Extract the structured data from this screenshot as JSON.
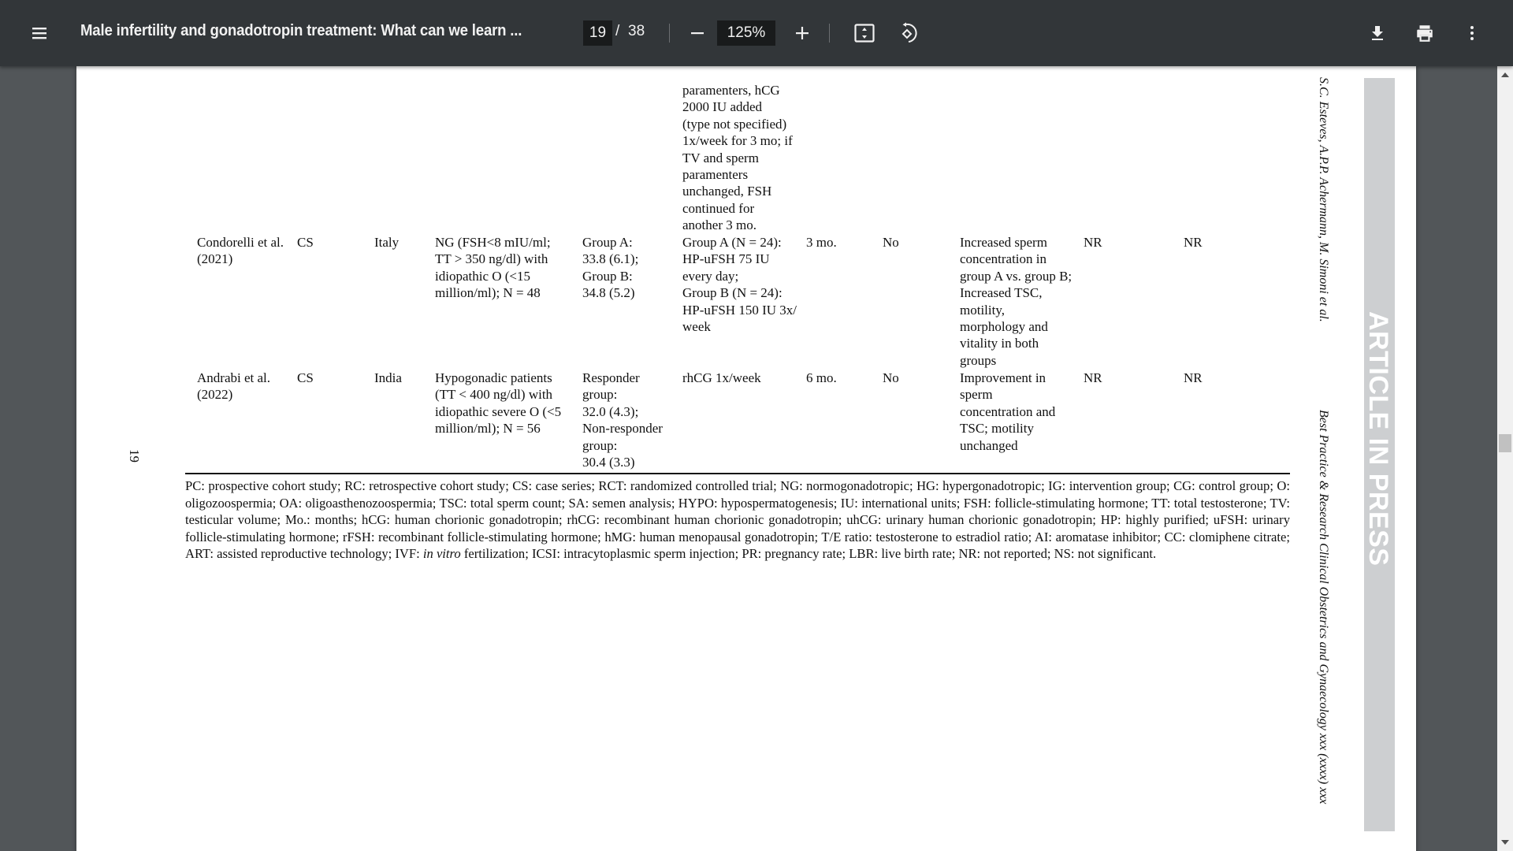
{
  "toolbar": {
    "menu_icon": "hamburger-menu-icon",
    "title": "Male infertility and gonadotropin treatment: What can we learn ...",
    "current_page": "19",
    "page_separator": "/",
    "total_pages": "38",
    "zoom_out_icon": "minus-icon",
    "zoom_level": "125%",
    "zoom_in_icon": "plus-icon",
    "fit_icon": "fit-to-page-icon",
    "rotate_icon": "rotate-counterclockwise-icon",
    "download_icon": "download-icon",
    "print_icon": "print-icon",
    "more_icon": "more-vertical-icon"
  },
  "page": {
    "page_number": "19",
    "running_head_authors": "S.C. Esteves, A.P.P. Achermann, M. Simoni et al.",
    "running_head_journal": "Best Practice & Research Clinical Obstetrics and Gynaecology xxx (xxxx) xxx",
    "watermark": "ARTICLE IN PRESS",
    "table": {
      "continued_treatment": "paramenters, hCG\n2000 IU added\n(type not specified)\n1x/week for 3 mo; if\nTV and sperm\nparamenters\nunchanged, FSH\ncontinued for\nanother 3 mo.",
      "rows": [
        {
          "study": "Condorelli et al.\n   (2021)",
          "design": "CS",
          "country": "Italy",
          "population": "NG (FSH<8 mIU/ml;\nTT > 350 ng/dl) with\nidiopathic O (<15\nmillion/ml); N = 48",
          "age": "Group A:\n33.8 (6.1);\nGroup B:\n34.8 (5.2)",
          "treatment": "Group A (N = 24):\nHP-uFSH 75 IU\nevery day;\nGroup B (N = 24):\nHP-uFSH 150 IU 3x/\nweek",
          "duration": "3 mo.",
          "control": "No",
          "outcome": "Increased sperm\nconcentration in\ngroup A vs. group B;\nIncreased TSC,\nmotility,\nmorphology and\nvitality in both\ngroups",
          "pr": "NR",
          "lbr": "NR"
        },
        {
          "study": "Andrabi et al.\n   (2022)",
          "design": "CS",
          "country": "India",
          "population": "Hypogonadic patients\n(TT < 400 ng/dl) with\nidiopathic severe O (<5\nmillion/ml); N = 56",
          "age": "Responder\ngroup:\n32.0 (4.3);\nNon-responder\ngroup:\n30.4 (3.3)",
          "treatment": "rhCG 1x/week",
          "duration": "6 mo.",
          "control": "No",
          "outcome": "Improvement in\nsperm\nconcentration and\nTSC; motility\nunchanged",
          "pr": "NR",
          "lbr": "NR"
        }
      ]
    },
    "footnote": "PC: prospective cohort study; RC: retrospective cohort study; CS: case series; RCT: randomized controlled trial; NG: normogonadotropic; HG: hypergonadotropic; IG: intervention group; CG: control group; O: oligozoospermia; OA: oligoasthenozoospermia; TSC: total sperm count; SA: semen analysis; HYPO: hypospermatogenesis; IU: international units; FSH: follicle-stimulating hormone; TT: total testosterone; TV: testicular volume; Mo.: months; hCG: human chorionic gonadotropin; rhCG: recombinant human chorionic gonadotropin; uhCG: urinary human chorionic gonadotropin; HP: highly purified; uFSH: urinary follicle-stimulating hormone; rFSH: recombinant follicle-stimulating hormone; hMG: human menopausal gonadotropin; T/E ratio: testosterone to estradiol ratio; AI: aromatase inhibitor; CC: clomiphene citrate; ART: assisted reproductive technology; IVF: in vitro fertilization; ICSI: intracytoplasmic sperm injection; PR: pregnancy rate; LBR: live birth rate; NR: not reported; NS: not significant."
  },
  "scrollbar": {
    "up_icon": "scroll-up-arrow-icon",
    "down_icon": "scroll-down-arrow-icon"
  }
}
